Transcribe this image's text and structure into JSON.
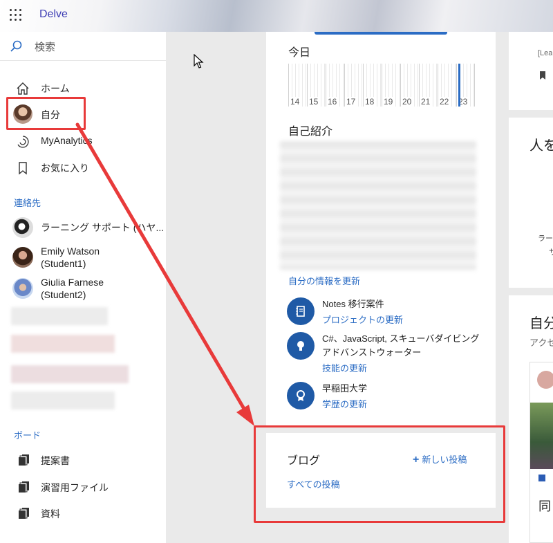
{
  "app": {
    "name": "Delve"
  },
  "search": {
    "placeholder": "検索"
  },
  "nav": [
    {
      "label": "ホーム",
      "icon": "home-icon"
    },
    {
      "label": "自分",
      "icon": "avatar"
    },
    {
      "label": "MyAnalytics",
      "icon": "analytics-icon"
    },
    {
      "label": "お気に入り",
      "icon": "bookmark-icon"
    }
  ],
  "contacts": {
    "title": "連絡先",
    "items": [
      {
        "name": "ラーニング サポート (ハヤ..."
      },
      {
        "name_line1": "Emily Watson",
        "name_line2": "(Student1)"
      },
      {
        "name_line1": "Giulia Farnese",
        "name_line2": "(Student2)"
      }
    ]
  },
  "boards": {
    "title": "ボード",
    "items": [
      {
        "label": "提案書"
      },
      {
        "label": "演習用ファイル"
      },
      {
        "label": "資料"
      }
    ]
  },
  "today": {
    "label": "今日",
    "days": [
      "14",
      "15",
      "16",
      "17",
      "18",
      "19",
      "20",
      "21",
      "22",
      "23"
    ]
  },
  "about": {
    "label": "自己紹介",
    "update_link": "自分の情報を更新"
  },
  "info": [
    {
      "title": "Notes 移行案件",
      "link": "プロジェクトの更新",
      "icon": "notebook-icon"
    },
    {
      "title": "C#、JavaScript, スキューバダイビング アドバンストウォーター",
      "link": "技能の更新",
      "icon": "lightbulb-icon"
    },
    {
      "title": "早稲田大学",
      "link": "学歴の更新",
      "icon": "award-icon"
    }
  ],
  "blog": {
    "title": "ブログ",
    "new_post": "新しい投稿",
    "all_posts": "すべての投稿"
  },
  "right": {
    "card1_text": "[Lea",
    "card2_title": "人を",
    "card2_small1": "ラー",
    "card2_small2": "サ",
    "card3_title": "自分",
    "card3_sub": "アクセ",
    "card3_bottom": "同"
  },
  "colors": {
    "accent": "#2b6cc4",
    "annotation": "#e83a3a",
    "brand": "#3b3bb3"
  }
}
